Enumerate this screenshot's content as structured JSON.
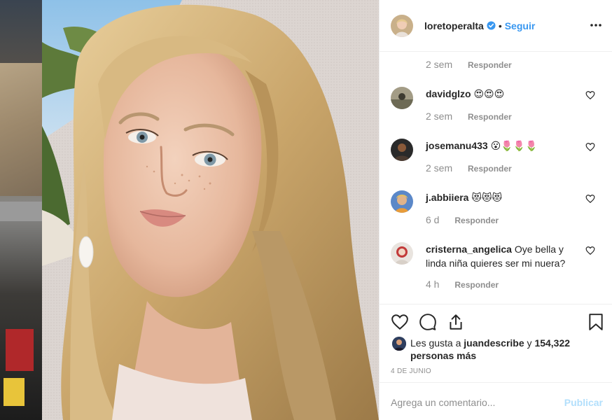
{
  "post": {
    "username": "loretoperalta",
    "follow_label": "Seguir",
    "separator": "•",
    "likes_prefix": "Les gusta a",
    "likes_user": "juandescribe",
    "likes_and": "y",
    "likes_count": "154,322 personas más",
    "date": "4 DE JUNIO"
  },
  "comments": [
    {
      "user": "",
      "text": "",
      "time": "2 sem",
      "reply": "Responder"
    },
    {
      "user": "davidglzo",
      "text": "😍😍😍",
      "time": "2 sem",
      "reply": "Responder"
    },
    {
      "user": "josemanu433",
      "text": "😮🌷🌷🌷",
      "time": "2 sem",
      "reply": "Responder"
    },
    {
      "user": "j.abbiiera",
      "text": "😻😻😻",
      "time": "6 d",
      "reply": "Responder"
    },
    {
      "user": "cristerna_angelica",
      "text": "Oye bella y linda niña quieres ser mi nuera?",
      "time": "4 h",
      "reply": "Responder"
    }
  ],
  "add_comment": {
    "placeholder": "Agrega un comentario...",
    "publish_label": "Publicar"
  },
  "colors": {
    "link_blue": "#3897f0",
    "publish_disabled": "#b2dffc",
    "text": "#262626",
    "muted": "#8e8e8e"
  },
  "icons": [
    "more-options-icon",
    "verified-badge-icon",
    "heart-icon",
    "comment-icon",
    "share-icon",
    "bookmark-icon"
  ]
}
